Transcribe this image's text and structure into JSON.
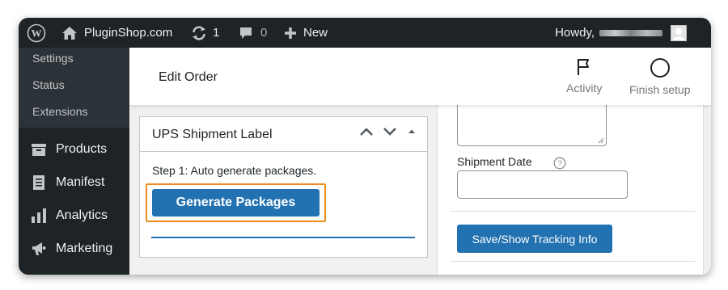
{
  "admin_bar": {
    "site_name": "PluginShop.com",
    "updates_count": "1",
    "comments_count": "0",
    "new_label": "New",
    "howdy_label": "Howdy,"
  },
  "sidebar": {
    "submenu": [
      {
        "label": "Settings"
      },
      {
        "label": "Status"
      },
      {
        "label": "Extensions"
      }
    ],
    "menu": [
      {
        "label": "Products",
        "icon": "archive-icon"
      },
      {
        "label": "Manifest",
        "icon": "document-icon"
      },
      {
        "label": "Analytics",
        "icon": "bar-chart-icon"
      },
      {
        "label": "Marketing",
        "icon": "megaphone-icon"
      }
    ]
  },
  "header": {
    "title": "Edit Order",
    "activity_label": "Activity",
    "finish_setup_label": "Finish setup"
  },
  "shipment_box": {
    "title": "UPS Shipment Label",
    "step_text": "Step 1: Auto generate packages.",
    "generate_button": "Generate Packages"
  },
  "tracking": {
    "shipment_date_label": "Shipment Date",
    "shipment_date_value": "",
    "save_button": "Save/Show Tracking Info"
  },
  "colors": {
    "admin_bar": "#1d2327",
    "primary_button": "#2271b1",
    "highlight": "#ee8d1f"
  }
}
